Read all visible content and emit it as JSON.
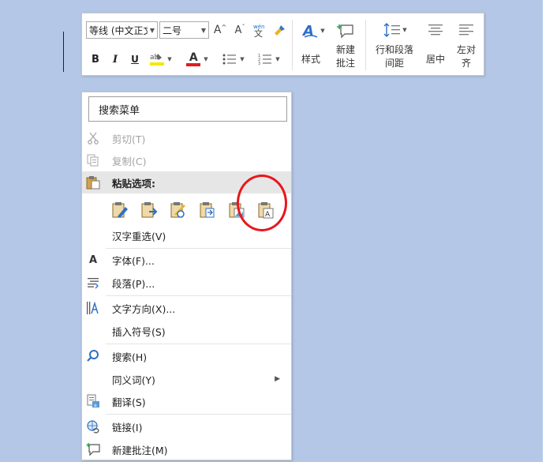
{
  "toolbar": {
    "font_family": "等线 (中文正文)",
    "font_size": "二号",
    "styles_label": "样式",
    "new_comment_label_1": "新建",
    "new_comment_label_2": "批注",
    "line_spacing_label_1": "行和段落",
    "line_spacing_label_2": "间距",
    "center_label": "居中",
    "align_left_label_1": "左对",
    "align_left_label_2": "齐",
    "bold": "B",
    "italic": "I",
    "underline": "U",
    "font_color_letter": "A",
    "grow_font": "A",
    "shrink_font": "A",
    "styles_letter": "A",
    "highlight_color": "#f5e800",
    "font_color": "#e31b23"
  },
  "menu": {
    "search_label": "搜索菜单",
    "cut": "剪切(T)",
    "copy": "复制(C)",
    "paste_options": "粘贴选项:",
    "reconvert": "汉字重选(V)",
    "font": "字体(F)...",
    "paragraph": "段落(P)...",
    "text_direction": "文字方向(X)...",
    "insert_symbol": "插入符号(S)",
    "search": "搜索(H)",
    "synonyms": "同义词(Y)",
    "translate": "翻译(S)",
    "link": "链接(I)",
    "new_comment": "新建批注(M)",
    "font_icon_letter": "A",
    "paste_icons": [
      "keep-source-formatting-icon",
      "merge-formatting-icon",
      "picture-icon",
      "use-destination-styles-icon",
      "paste-picture-icon",
      "keep-text-only-icon"
    ],
    "highlight_circle_color": "#e8161c"
  }
}
